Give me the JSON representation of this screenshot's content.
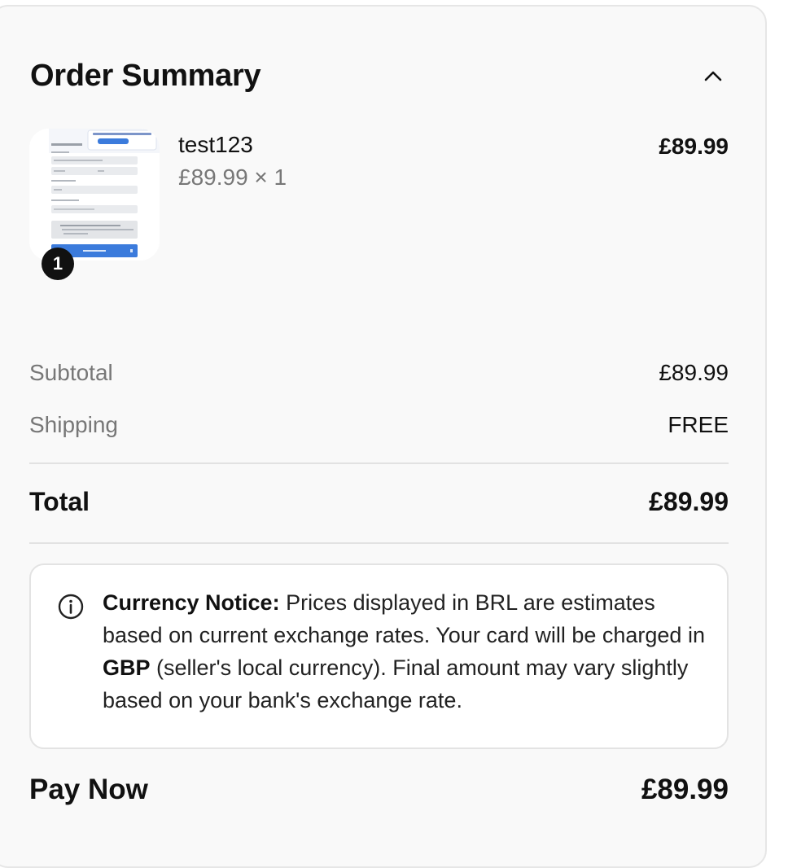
{
  "summary": {
    "title": "Order Summary",
    "collapse_icon": "chevron-up-icon"
  },
  "item": {
    "name": "test123",
    "unit_line": "£89.99 × 1",
    "price": "£89.99",
    "quantity_badge": "1",
    "thumbnail": "payment-form-screenshot"
  },
  "totals": {
    "subtotal_label": "Subtotal",
    "subtotal_value": "£89.99",
    "shipping_label": "Shipping",
    "shipping_value": "FREE",
    "total_label": "Total",
    "total_value": "£89.99"
  },
  "notice": {
    "icon": "info-icon",
    "title": "Currency Notice:",
    "text_before": " Prices displayed in BRL are estimates based on current exchange rates. Your card will be charged in ",
    "currency": "GBP",
    "text_after": " (seller's local currency). Final amount may vary slightly based on your bank's exchange rate."
  },
  "pay_now": {
    "label": "Pay Now",
    "value": "£89.99"
  },
  "colors": {
    "panel_bg": "#f9f9f9",
    "badge_bg": "#111111",
    "muted_text": "#777777",
    "divider": "#e2e2e2",
    "thumb_accent": "#3b7bdc"
  }
}
